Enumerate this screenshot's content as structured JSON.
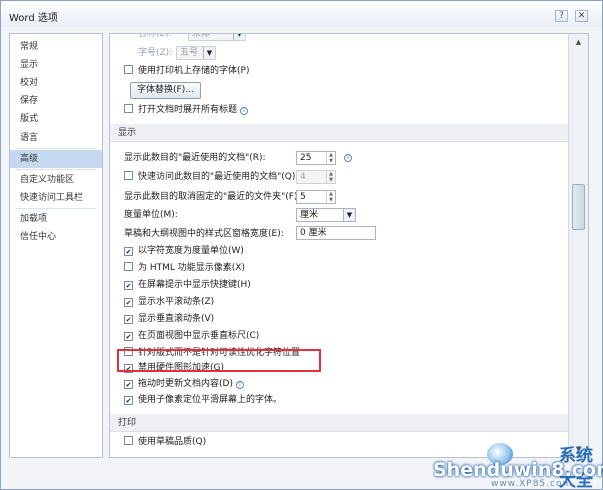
{
  "window": {
    "title": "Word 选项",
    "help_glyph": "?",
    "close_glyph": "✕"
  },
  "sidebar": {
    "items": [
      {
        "label": "常规"
      },
      {
        "label": "显示"
      },
      {
        "label": "校对"
      },
      {
        "label": "保存"
      },
      {
        "label": "版式"
      },
      {
        "label": "语言"
      },
      {
        "label": "高级",
        "active": true
      },
      {
        "label": "自定义功能区"
      },
      {
        "label": "快速访问工具栏"
      },
      {
        "label": "加载项"
      },
      {
        "label": "信任中心"
      }
    ]
  },
  "content": {
    "top": {
      "font_name_label": "名称(E):",
      "font_name_value": "宋体",
      "font_size_label": "字号(Z):",
      "font_size_value": "五号",
      "printer_fonts_label": "使用打印机上存储的字体(P)",
      "printer_fonts_checked": false,
      "font_substitution_button": "字体替换(F)...",
      "expand_headings_label": "打开文档时展开所有标题",
      "expand_headings_checked": false
    },
    "display": {
      "header": "显示",
      "recent_docs_label": "显示此数目的\"最近使用的文档\"(R):",
      "recent_docs_value": "25",
      "quick_access_label": "快速访问此数目的\"最近使用的文档\"(Q):",
      "quick_access_value": "4",
      "quick_access_checked": false,
      "recent_folders_label": "显示此数目的取消固定的\"最近的文件夹\"(F):",
      "recent_folders_value": "5",
      "units_label": "度量单位(M):",
      "units_value": "厘米",
      "style_area_label": "草稿和大纲视图中的样式区窗格宽度(E):",
      "style_area_value": "0 厘米",
      "options": [
        {
          "label": "以字符宽度为度量单位(W)",
          "checked": true
        },
        {
          "label": "为 HTML 功能显示像素(X)",
          "checked": false
        },
        {
          "label": "在屏幕提示中显示快捷键(H)",
          "checked": true
        },
        {
          "label": "显示水平滚动条(Z)",
          "checked": true
        },
        {
          "label": "显示垂直滚动条(V)",
          "checked": true
        },
        {
          "label": "在页面视图中显示垂直标尺(C)",
          "checked": true
        },
        {
          "label": "针对版式而不是针对可读性优化字符位置",
          "checked": false
        },
        {
          "label": "禁用硬件图形加速(G)",
          "checked": true
        },
        {
          "label": "拖动时更新文档内容(D)",
          "checked": true
        },
        {
          "label": "使用子像素定位平滑屏幕上的字体。",
          "checked": true
        }
      ]
    },
    "print": {
      "header": "打印",
      "draft_quality_label": "使用草稿品质(Q)",
      "draft_quality_checked": false
    }
  },
  "icons": {
    "info": "i",
    "dropdown": "▼",
    "spin_up": "▲",
    "spin_down": "▼",
    "scroll_up": "▲",
    "scroll_down": "▼"
  },
  "watermark": {
    "main": "Shenduwin8.com",
    "sub": "www.XP85.com",
    "tail": "系统大全"
  }
}
